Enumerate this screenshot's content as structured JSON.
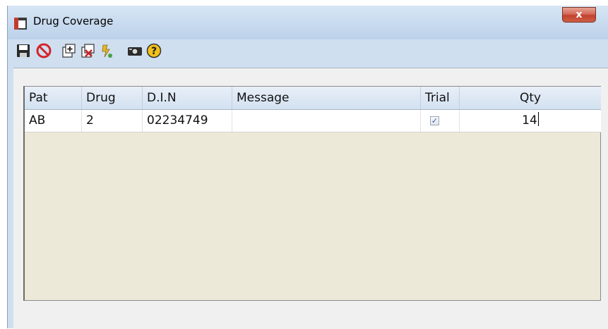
{
  "window": {
    "title": "Drug Coverage",
    "close_label": "x"
  },
  "toolbar": {
    "buttons": [
      {
        "icon": "save-icon"
      },
      {
        "icon": "cancel-icon"
      },
      {
        "icon": "add-icon"
      },
      {
        "icon": "delete-icon"
      },
      {
        "icon": "edit-icon"
      },
      {
        "icon": "camera-icon"
      },
      {
        "icon": "help-icon"
      }
    ]
  },
  "grid": {
    "columns": [
      "Pat",
      "Drug",
      "D.I.N",
      "Message",
      "Trial",
      "Qty"
    ],
    "rows": [
      {
        "pat": "AB",
        "drug": "2",
        "din": "02234749",
        "message": "",
        "trial": true,
        "qty": "14"
      }
    ]
  },
  "colors": {
    "title_bg": "#c6d9ee",
    "grid_bg": "#ece9d8",
    "close_btn": "#c2412d"
  }
}
